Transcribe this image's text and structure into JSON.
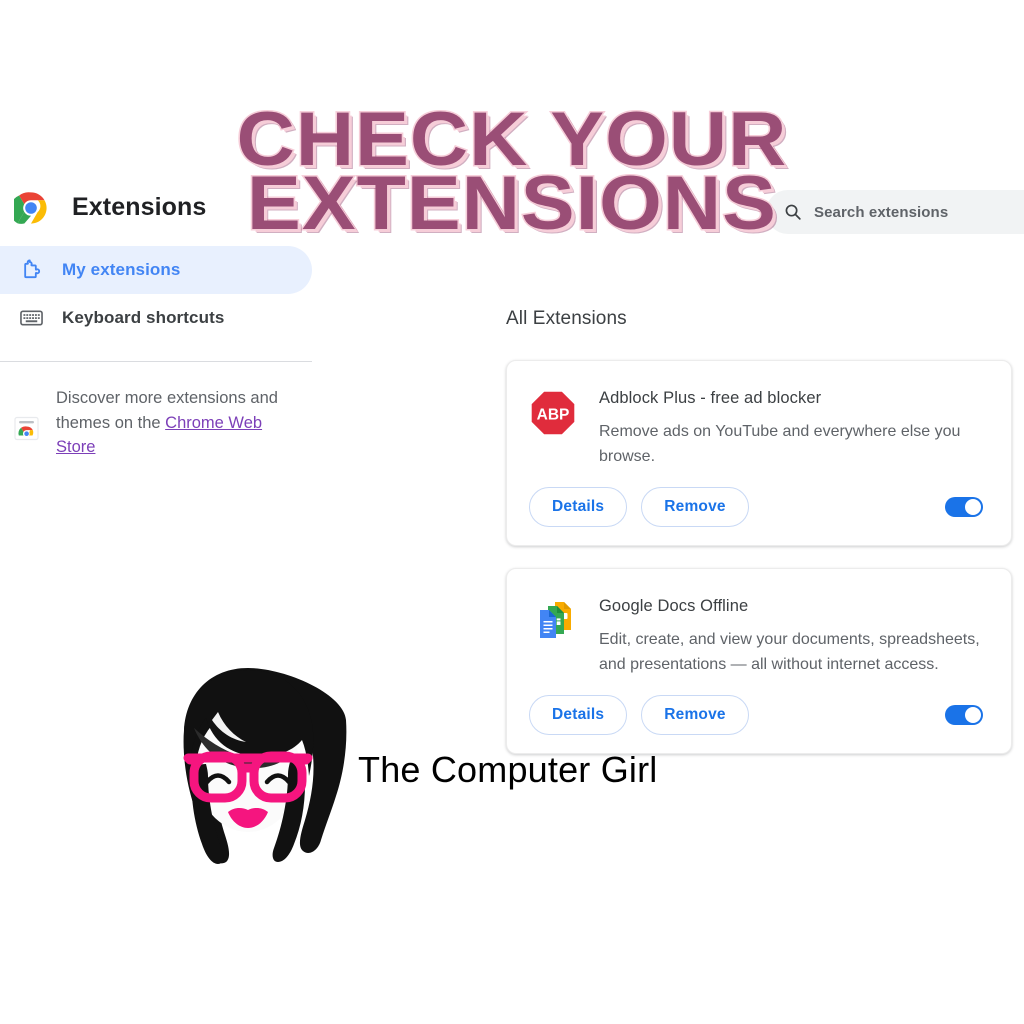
{
  "overlay": {
    "line1": "CHECK YOUR",
    "line2": "EXTENSIONS",
    "text_color": "#9a4e76",
    "outline_color": "#f6cdd8"
  },
  "header": {
    "title": "Extensions",
    "logo_icon": "chrome-logo"
  },
  "search": {
    "placeholder": "Search extensions",
    "icon": "search-icon"
  },
  "sidebar": {
    "items": [
      {
        "label": "My extensions",
        "icon": "puzzle-piece-icon",
        "active": true
      },
      {
        "label": "Keyboard shortcuts",
        "icon": "keyboard-icon",
        "active": false
      }
    ],
    "discover": {
      "icon": "chrome-web-store-icon",
      "text_before": "Discover more extensions and themes on the ",
      "link_text": "Chrome Web Store"
    }
  },
  "main": {
    "section_title": "All Extensions",
    "buttons": {
      "details": "Details",
      "remove": "Remove"
    },
    "extensions": [
      {
        "name": "Adblock Plus - free ad blocker",
        "description": "Remove ads on YouTube and everywhere else you browse.",
        "icon": "adblock-plus-icon",
        "icon_label": "ABP",
        "enabled": true
      },
      {
        "name": "Google Docs Offline",
        "description": "Edit, create, and view your documents, spreadsheets, and presentations — all without internet access.",
        "icon": "google-docs-offline-icon",
        "enabled": true
      }
    ]
  },
  "branding": {
    "name": "The Computer Girl",
    "avatar_icon": "computer-girl-avatar-icon"
  },
  "colors": {
    "accent_blue": "#1a73e8",
    "active_nav_bg": "#e8f0fe",
    "link_purple": "#7c3fb8",
    "brand_pink": "#f5157f"
  }
}
